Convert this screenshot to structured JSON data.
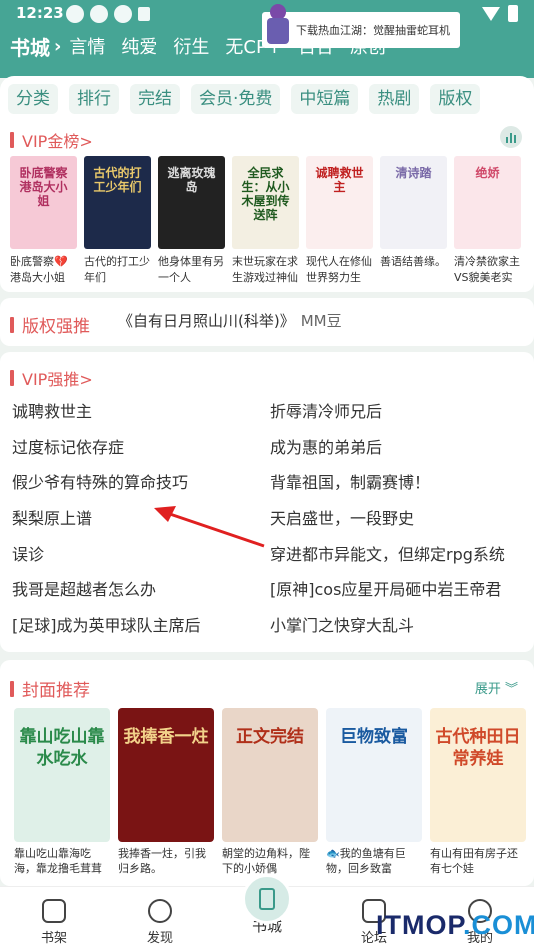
{
  "status": {
    "time": "12:23"
  },
  "banner": {
    "text": "下载热血江湖：觉醒抽雷蛇耳机"
  },
  "nav": {
    "title": "书城",
    "items": [
      "言情",
      "纯爱",
      "衍生",
      "无CP+",
      "百合",
      "原创"
    ]
  },
  "categories": [
    "分类",
    "排行",
    "完结",
    "会员·免费",
    "中短篇",
    "热剧",
    "版权"
  ],
  "vip_rank": {
    "title": "VIP金榜>",
    "books": [
      {
        "cover_text": "卧底警察港岛大小姐",
        "title": "卧底警察💔港岛大小姐",
        "bg": "#f6c9d6",
        "fg": "#b03060"
      },
      {
        "cover_text": "古代的打工少年们",
        "title": "古代的打工少年们",
        "bg": "#1d2a4a",
        "fg": "#e8c86a"
      },
      {
        "cover_text": "逃离玫瑰岛",
        "title": "他身体里有另一个人",
        "bg": "#222",
        "fg": "#ddd"
      },
      {
        "cover_text": "全民求生：从小木屋到传送阵",
        "title": "末世玩家在求生游戏过神仙",
        "bg": "#f3efe2",
        "fg": "#1f5a1f"
      },
      {
        "cover_text": "诚聘救世主",
        "title": "现代人在修仙世界努力生",
        "bg": "#fbeeee",
        "fg": "#c02020"
      },
      {
        "cover_text": "清诗踏",
        "title": "善语结善缘。",
        "bg": "#f1f1f6",
        "fg": "#7a6aa8"
      },
      {
        "cover_text": "绝娇",
        "title": "清冷禁欲家主VS貌美老实娇",
        "bg": "#fbe6ea",
        "fg": "#d04a6a"
      }
    ]
  },
  "copyright": {
    "title": "版权强推",
    "book": "《自有日月照山川(科举)》",
    "author": "MM豆"
  },
  "vip_push": {
    "title": "VIP强推>",
    "left": [
      "诚聘救世主",
      "过度标记依存症",
      "假少爷有特殊的算命技巧",
      "梨梨原上谱",
      "误诊",
      "我哥是超越者怎么办",
      "[足球]成为英甲球队主席后"
    ],
    "right": [
      "折辱清冷师兄后",
      "成为惠的弟弟后",
      "背靠祖国，制霸赛博！",
      "天启盛世，一段野史",
      "穿进都市异能文，但绑定rpg系统",
      "[原神]cos应星开局砸中岩王帝君",
      "小掌门之快穿大乱斗"
    ]
  },
  "cover_rec": {
    "title": "封面推荐",
    "expand": "展开",
    "books": [
      {
        "cover_text": "靠山吃山靠水吃水",
        "title": "靠山吃山靠海吃海，靠龙撸毛茸茸",
        "bg": "#dff0e8",
        "fg": "#2a8a4a"
      },
      {
        "cover_text": "我捧香一炷",
        "title": "我捧香一炷，引我归乡路。",
        "bg": "#7a1414",
        "fg": "#f2d28a"
      },
      {
        "cover_text": "正文完结",
        "title": "朝堂的边角料，陛下的小娇偶",
        "bg": "#e9d6c8",
        "fg": "#b0301a"
      },
      {
        "cover_text": "巨物致富",
        "title": "🐟我的鱼塘有巨物，回乡致富",
        "bg": "#eef3f8",
        "fg": "#1a5aa0"
      },
      {
        "cover_text": "古代种田日常养娃",
        "title": "有山有田有房子还有七个娃",
        "bg": "#fbefd6",
        "fg": "#d04a2a"
      }
    ]
  },
  "tabs": [
    "书架",
    "发现",
    "书城",
    "论坛",
    "我的"
  ],
  "watermark": {
    "text_a": "ITMOP",
    "text_b": ".COM"
  }
}
